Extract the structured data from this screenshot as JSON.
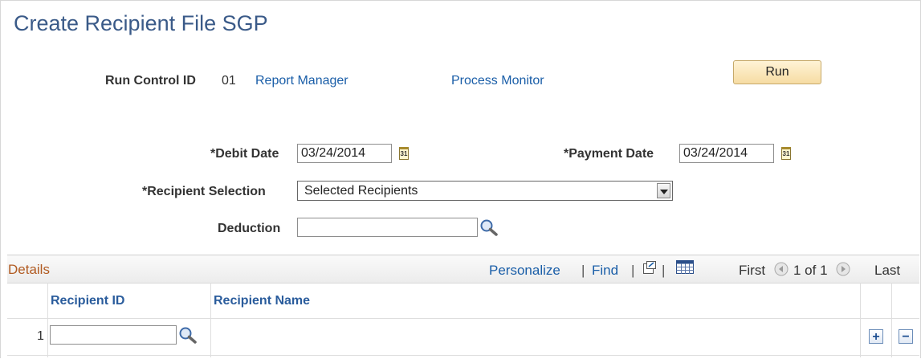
{
  "page": {
    "title": "Create Recipient File SGP"
  },
  "run_control": {
    "label": "Run Control ID",
    "value": "01",
    "report_manager": "Report Manager",
    "process_monitor": "Process Monitor",
    "run_label": "Run"
  },
  "form": {
    "debit_date": {
      "label": "*Debit Date",
      "value": "03/24/2014",
      "cal_glyph": "31"
    },
    "payment_date": {
      "label": "*Payment Date",
      "value": "03/24/2014",
      "cal_glyph": "31"
    },
    "recipient_selection": {
      "label": "*Recipient Selection",
      "value": "Selected Recipients"
    },
    "deduction": {
      "label": "Deduction",
      "value": ""
    }
  },
  "grid": {
    "title": "Details",
    "personalize": "Personalize",
    "find": "Find",
    "separator": "|",
    "first": "First",
    "range": "1 of 1",
    "last": "Last",
    "columns": [
      "Recipient ID",
      "Recipient Name"
    ],
    "rows": [
      {
        "num": "1",
        "recipient_id": "",
        "recipient_name": ""
      }
    ],
    "add_glyph": "+",
    "remove_glyph": "−"
  },
  "colors": {
    "title": "#3a5a88",
    "link": "#1a5ea8",
    "grid_title": "#b15b22",
    "run_button": "#f6dca3"
  }
}
